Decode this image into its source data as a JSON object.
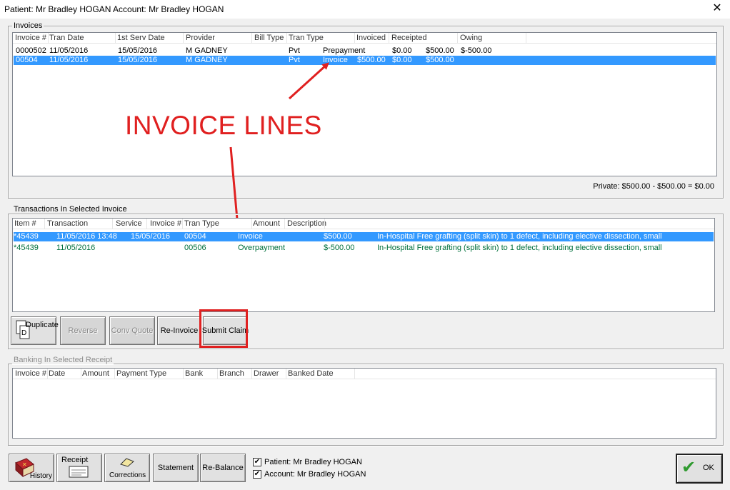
{
  "window": {
    "title": "Patient: Mr Bradley HOGAN  Account: Mr Bradley HOGAN",
    "close_glyph": "✕"
  },
  "invoices": {
    "legend": "Invoices",
    "columns": [
      "Invoice #",
      "Tran Date",
      "1st Serv Date",
      "Provider",
      "Bill Type",
      "Tran Type",
      "Invoiced",
      "Receipted",
      "Owing"
    ],
    "rows": [
      {
        "invoice": "0000502",
        "tran_date": "11/05/2016",
        "first_serv": "15/05/2016",
        "provider": "M GADNEY",
        "bill_type": "Pvt",
        "tran_type": "Prepayment",
        "invoiced": "$0.00",
        "receipted": "$500.00",
        "owing": "$-500.00",
        "selected": false
      },
      {
        "invoice": "00504",
        "tran_date": "11/05/2016",
        "first_serv": "15/05/2016",
        "provider": "M GADNEY",
        "bill_type": "Pvt",
        "tran_type": "Invoice",
        "invoiced": "$500.00",
        "receipted": "$0.00",
        "owing": "$500.00",
        "selected": true
      }
    ],
    "summary": "Private: $500.00 - $500.00 = $0.00"
  },
  "annotation": {
    "label": "INVOICE LINES",
    "color": "#e02020"
  },
  "transactions": {
    "legend": "Transactions In Selected Invoice",
    "columns": [
      "Item #",
      "Transaction",
      "Service",
      "Invoice #",
      "Tran Type",
      "Amount",
      "Description"
    ],
    "rows": [
      {
        "item": "*45439",
        "transaction": "11/05/2016 13:48",
        "service": "15/05/2016",
        "invoice": "00504",
        "tran_type": "Invoice",
        "amount": "$500.00",
        "description": "In-Hospital Free grafting (split skin) to 1 defect, including elective dissection, small",
        "selected": true
      },
      {
        "item": "*45439",
        "transaction": "11/05/2016",
        "service": "",
        "invoice": "00506",
        "tran_type": "Overpayment",
        "amount": "$-500.00",
        "description": "In-Hospital Free grafting (split skin) to 1 defect, including elective dissection, small",
        "selected": false
      }
    ],
    "buttons": {
      "duplicate": "Duplicate",
      "reverse": "Reverse",
      "conv_quote": "Conv Quote",
      "reinvoice": "Re-Invoice",
      "submit_claim": "Submit Claim"
    }
  },
  "banking": {
    "legend": "Banking In Selected Receipt",
    "columns": [
      "Invoice #",
      "Date",
      "Amount",
      "Payment Type",
      "Bank",
      "Branch",
      "Drawer",
      "Banked Date"
    ]
  },
  "footer": {
    "history": "History",
    "receipt": "Receipt",
    "corrections": "Corrections",
    "statement": "Statement",
    "rebalance": "Re-Balance",
    "patient_check": "Patient: Mr Bradley HOGAN",
    "account_check": "Account: Mr Bradley HOGAN",
    "ok": "OK",
    "check_glyph": "✔"
  }
}
